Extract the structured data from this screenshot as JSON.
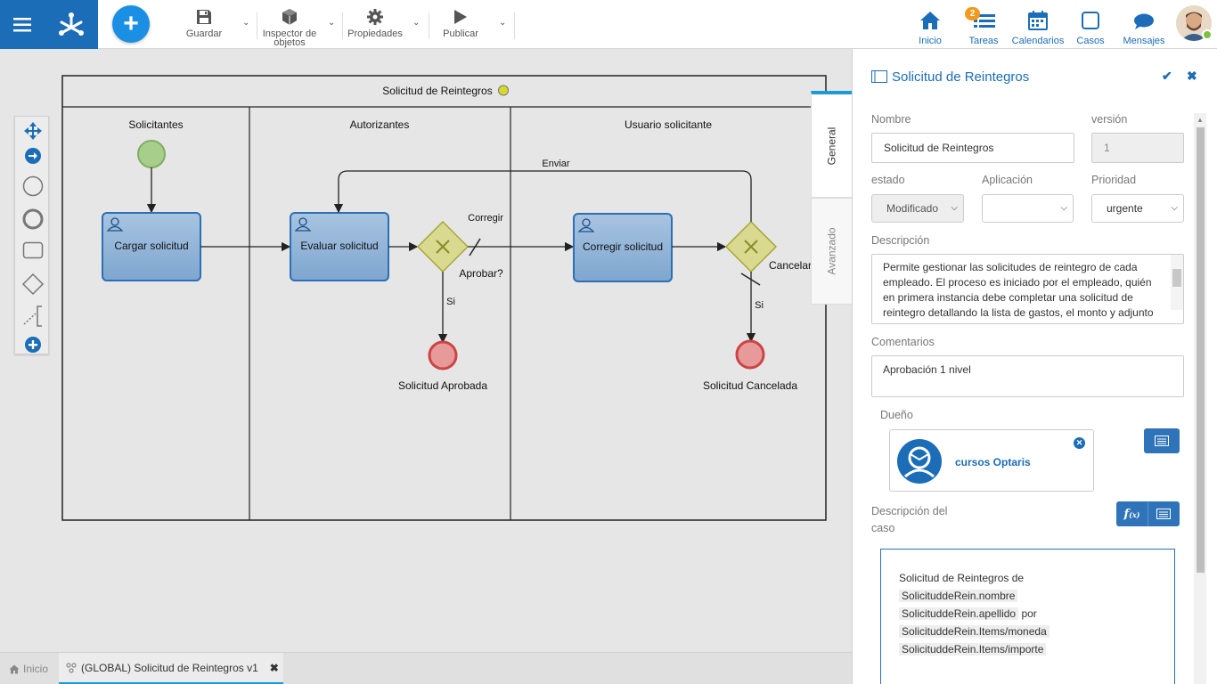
{
  "toolbar": {
    "save": "Guardar",
    "object_inspector": "Inspector de objetos",
    "properties": "Propiedades",
    "publish": "Publicar"
  },
  "nav": {
    "home": "Inicio",
    "tasks": "Tareas",
    "tasks_badge": "2",
    "calendars": "Calendarios",
    "cases": "Casos",
    "messages": "Mensajes"
  },
  "diagram": {
    "pool_title": "Solicitud de Reintegros",
    "lanes": [
      "Solicitantes",
      "Autorizantes",
      "Usuario solicitante"
    ],
    "tasks": [
      "Cargar solicitud",
      "Evaluar solicitud",
      "Corregir solicitud"
    ],
    "gateway_label": "Aprobar?",
    "flows": {
      "send": "Enviar",
      "correct": "Corregir",
      "yes1": "Si",
      "yes2": "Si",
      "cancel": "Cancelar"
    },
    "end_events": [
      "Solicitud Aprobada",
      "Solicitud Cancelada"
    ]
  },
  "bottom_tabs": {
    "home": "Inicio",
    "process": "(GLOBAL) Solicitud de Reintegros v1"
  },
  "panel": {
    "title": "Solicitud de Reintegros",
    "tabs": [
      "General",
      "Avanzado"
    ],
    "name_label": "Nombre",
    "name_value": "Solicitud de Reintegros",
    "version_label": "versión",
    "version_value": "1",
    "state_label": "estado",
    "state_value": "Modificado",
    "app_label": "Aplicación",
    "app_value": "",
    "priority_label": "Prioridad",
    "priority_value": "urgente",
    "desc_label": "Descripción",
    "desc_value": "Permite gestionar las solicitudes de reintegro de cada empleado. El proceso es iniciado por el empleado, quién en primera instancia debe completar una solicitud de reintegro detallando la lista de gastos, el monto y adjunto comprobantes de cada gasto. Luego la solicitud es",
    "comments_label": "Comentarios",
    "comments_value": "Aprobación 1 nivel",
    "owner_label": "Dueño",
    "owner_name": "cursos Optaris",
    "case_desc_label": "Descripción del caso",
    "case_desc_intro": "Solicitud de Reintegros de",
    "case_desc_tokens": [
      "SolicituddeRein.nombre",
      "SolicituddeRein.apellido",
      "SolicituddeRein.Items/moneda",
      "SolicituddeRein.Items/importe"
    ],
    "case_desc_por": "por"
  }
}
